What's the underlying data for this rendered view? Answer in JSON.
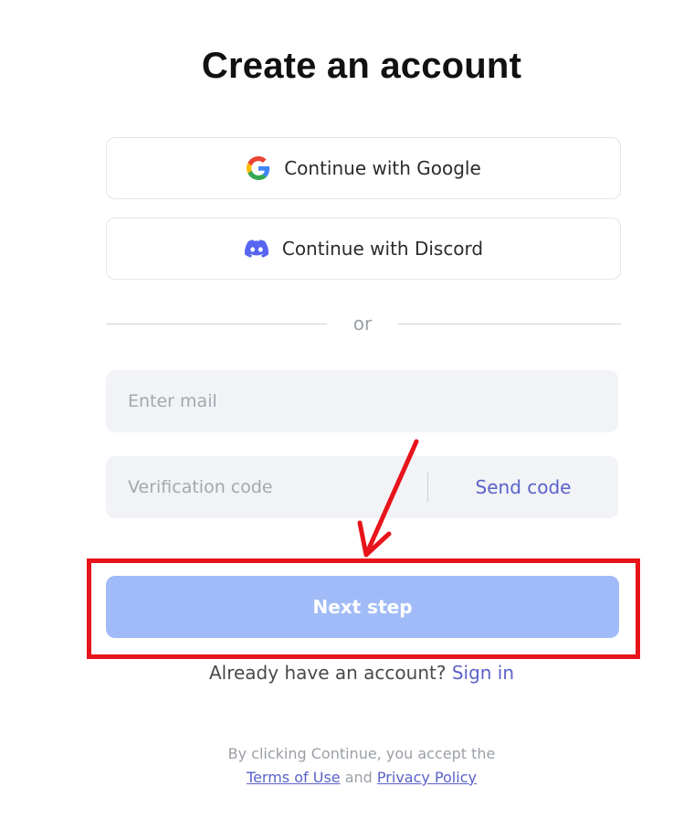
{
  "title": "Create an account",
  "social": {
    "google_label": "Continue with Google",
    "discord_label": "Continue with Discord"
  },
  "divider_text": "or",
  "form": {
    "email_placeholder": "Enter mail",
    "email_value": "",
    "code_placeholder": "Verification code",
    "code_value": "",
    "send_code_label": "Send code",
    "next_label": "Next step"
  },
  "signin": {
    "prompt": "Already have an account?",
    "link_label": "Sign in"
  },
  "legal": {
    "line1": "By clicking Continue, you accept the",
    "terms_label": "Terms of Use",
    "and": "and",
    "privacy_label": "Privacy Policy"
  },
  "colors": {
    "accent": "#5a62c8",
    "next_button_bg": "#a0bbf7",
    "annotation_red": "#e8141b",
    "discord": "#5865f2"
  },
  "icons": [
    "google-icon",
    "discord-icon"
  ]
}
